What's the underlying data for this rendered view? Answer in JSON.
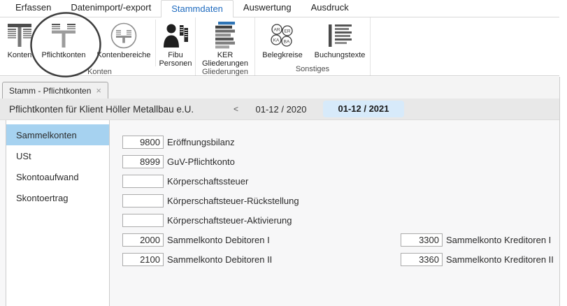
{
  "menu": {
    "tabs": [
      {
        "label": "Erfassen",
        "active": false
      },
      {
        "label": "Datenimport/-export",
        "active": false
      },
      {
        "label": "Stammdaten",
        "active": true
      },
      {
        "label": "Auswertung",
        "active": false
      },
      {
        "label": "Ausdruck",
        "active": false
      }
    ]
  },
  "ribbon": {
    "groups": [
      {
        "label": "Konten",
        "items": [
          {
            "label": "Konten"
          },
          {
            "label": "Pflichtkonten"
          },
          {
            "label": "Kontenbereiche"
          },
          {
            "label": "Fibu Personen"
          }
        ]
      },
      {
        "label": "Gliederungen",
        "items": [
          {
            "label": "KER Gliederungen"
          }
        ]
      },
      {
        "label": "Sonstiges",
        "items": [
          {
            "label": "Belegkreise"
          },
          {
            "label": "Buchungstexte"
          }
        ]
      }
    ],
    "belegkreise_badges": [
      "AR",
      "ER",
      "KA",
      "BA"
    ]
  },
  "annotation": {
    "circled_item": "Pflichtkonten"
  },
  "document_tab": {
    "label": "Stamm - Pflichtkonten",
    "close_icon": "×"
  },
  "header": {
    "title": "Pflichtkonten für Klient Höller Metallbau e.U.",
    "prev_arrow": "<",
    "periods": [
      {
        "label": "01-12 / 2020",
        "selected": false
      },
      {
        "label": "01-12 / 2021",
        "selected": true
      }
    ]
  },
  "sidebar": {
    "items": [
      {
        "label": "Sammelkonten",
        "selected": true
      },
      {
        "label": "USt",
        "selected": false
      },
      {
        "label": "Skontoaufwand",
        "selected": false
      },
      {
        "label": "Skontoertrag",
        "selected": false
      }
    ]
  },
  "fields": {
    "left": [
      {
        "value": "9800",
        "label": "Eröffnungsbilanz"
      },
      {
        "value": "8999",
        "label": "GuV-Pflichtkonto"
      },
      {
        "value": "",
        "label": "Körperschaftssteuer"
      },
      {
        "value": "",
        "label": "Körperschaftsteuer-Rückstellung"
      },
      {
        "value": "",
        "label": "Körperschaftsteuer-Aktivierung"
      },
      {
        "value": "2000",
        "label": "Sammelkonto Debitoren I"
      },
      {
        "value": "2100",
        "label": "Sammelkonto Debitoren II"
      }
    ],
    "right": [
      {
        "value": "3300",
        "label": "Sammelkonto Kreditoren I"
      },
      {
        "value": "3360",
        "label": "Sammelkonto Kreditoren II"
      }
    ]
  },
  "colors": {
    "accent_blue": "#1f6bbf",
    "selected_sidebar_bg": "#a6d2f0",
    "period_chip_bg": "#d7eafa",
    "ker_bar_blue": "#2e74b5"
  }
}
